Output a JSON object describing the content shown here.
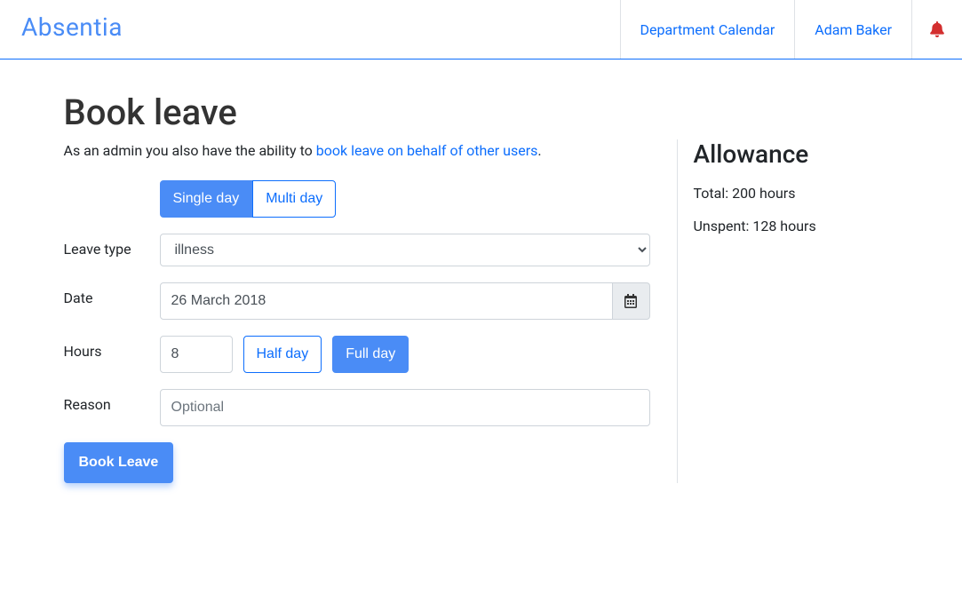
{
  "nav": {
    "brand": "Absentia",
    "links": {
      "calendar": "Department Calendar",
      "user": "Adam Baker"
    }
  },
  "page": {
    "title": "Book leave",
    "subtitle_prefix": "As an admin you also have the ability to ",
    "subtitle_link": "book leave on behalf of other users",
    "subtitle_suffix": "."
  },
  "tabs": {
    "single": "Single day",
    "multi": "Multi day"
  },
  "form": {
    "leave_type_label": "Leave type",
    "leave_type_value": "illness",
    "date_label": "Date",
    "date_value": "26 March 2018",
    "hours_label": "Hours",
    "hours_value": "8",
    "half_day": "Half day",
    "full_day": "Full day",
    "reason_label": "Reason",
    "reason_placeholder": "Optional",
    "submit": "Book Leave"
  },
  "allowance": {
    "heading": "Allowance",
    "total": "Total: 200 hours",
    "unspent": "Unspent: 128 hours"
  }
}
